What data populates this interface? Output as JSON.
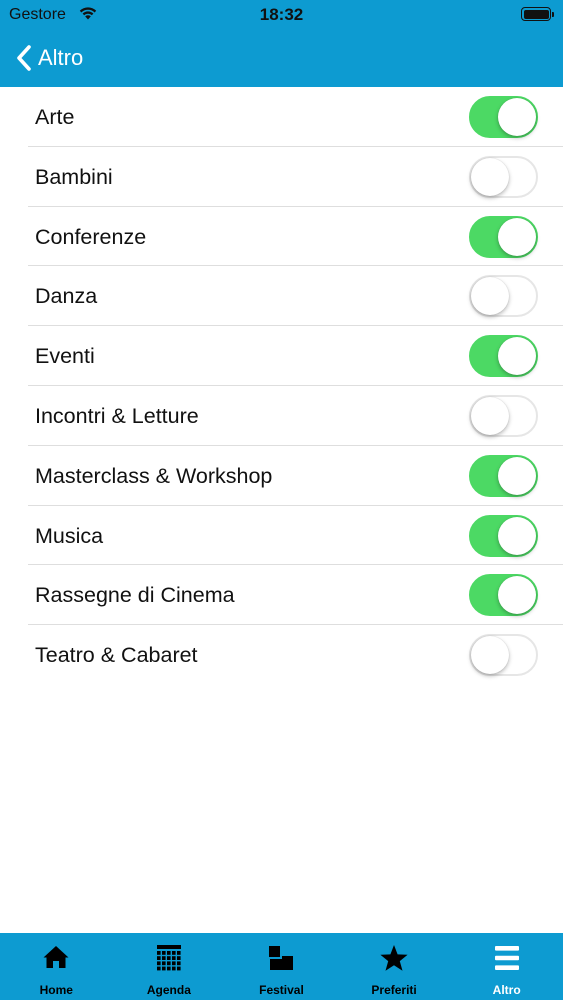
{
  "status_bar": {
    "carrier": "Gestore",
    "time": "18:32"
  },
  "nav": {
    "back_label": "Altro"
  },
  "categories": [
    {
      "label": "Arte",
      "on": true
    },
    {
      "label": "Bambini",
      "on": false
    },
    {
      "label": "Conferenze",
      "on": true
    },
    {
      "label": "Danza",
      "on": false
    },
    {
      "label": "Eventi",
      "on": true
    },
    {
      "label": "Incontri & Letture",
      "on": false
    },
    {
      "label": "Masterclass & Workshop",
      "on": true
    },
    {
      "label": "Musica",
      "on": true
    },
    {
      "label": "Rassegne di Cinema",
      "on": true
    },
    {
      "label": "Teatro & Cabaret",
      "on": false
    }
  ],
  "tabs": [
    {
      "label": "Home",
      "icon": "home-icon",
      "active": false
    },
    {
      "label": "Agenda",
      "icon": "calendar-grid-icon",
      "active": false
    },
    {
      "label": "Festival",
      "icon": "festival-icon",
      "active": false
    },
    {
      "label": "Preferiti",
      "icon": "star-icon",
      "active": false
    },
    {
      "label": "Altro",
      "icon": "menu-icon",
      "active": true
    }
  ],
  "colors": {
    "brand_blue": "#0d9bd1",
    "toggle_on": "#4cd964",
    "toggle_off_border": "#e6e6e6",
    "tab_active_label": "#ffffff",
    "tab_inactive_label": "#000000"
  }
}
